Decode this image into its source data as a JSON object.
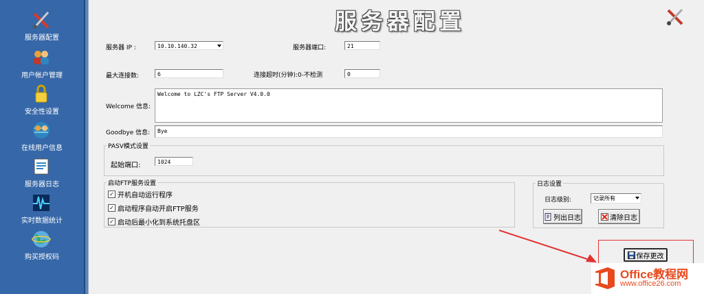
{
  "sidebar": {
    "items": [
      {
        "label": "服务器配置",
        "icon": "tools-icon"
      },
      {
        "label": "用户帐户管理",
        "icon": "users-icon"
      },
      {
        "label": "安全性设置",
        "icon": "lock-icon"
      },
      {
        "label": "在线用户信息",
        "icon": "online-users-icon"
      },
      {
        "label": "服务器日志",
        "icon": "log-icon"
      },
      {
        "label": "实时数据统计",
        "icon": "chart-pulse-icon"
      },
      {
        "label": "购买授权码",
        "icon": "globe-icon"
      }
    ]
  },
  "page": {
    "title": "服务器配置",
    "server_ip_label": "服务器 IP :",
    "server_ip_value": "10.10.140.32",
    "server_port_label": "服务器端口:",
    "server_port_value": "21",
    "max_conn_label": "最大连接数:",
    "max_conn_value": "6",
    "timeout_label": "连接超时(分钟):0-不检测",
    "timeout_value": "0",
    "welcome_label": "Welcome 信息:",
    "welcome_value": "Welcome to LZC's FTP Server V4.0.0",
    "goodbye_label": "Goodbye 信息:",
    "goodbye_value": "Bye",
    "pasv_group": "PASV模式设置",
    "start_port_label": "起始端口:",
    "start_port_value": "1024",
    "autostart_group": "启动FTP服务设置",
    "checkboxes": [
      {
        "label": "开机自动运行程序",
        "checked": true
      },
      {
        "label": "启动程序自动开启FTP服务",
        "checked": true
      },
      {
        "label": "启动后最小化到系统托盘区",
        "checked": true
      }
    ],
    "log_group": "日志设置",
    "log_level_label": "日志级别:",
    "log_level_value": "记录所有",
    "list_log_button": "列出日志",
    "clear_log_button": "清除日志",
    "save_button": "保存更改"
  },
  "watermark": {
    "brand": "Office教程网",
    "url": "www.office26.com"
  }
}
